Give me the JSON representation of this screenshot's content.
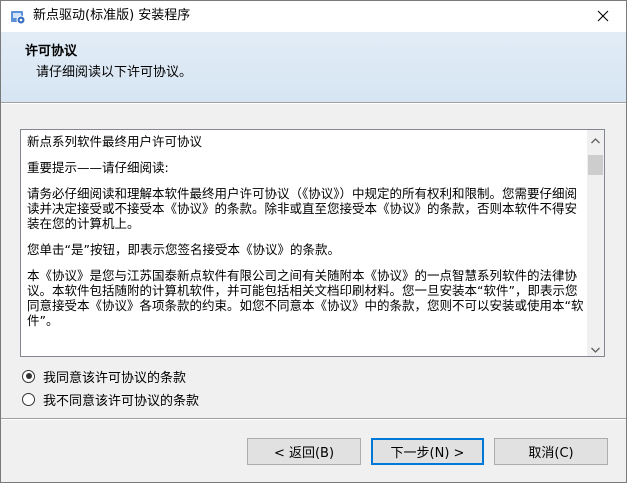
{
  "window": {
    "title": "新点驱动(标准版) 安装程序"
  },
  "header": {
    "title": "许可协议",
    "subtitle": "请仔细阅读以下许可协议。"
  },
  "license": {
    "paragraphs": [
      "新点系列软件最终用户许可协议",
      "重要提示——请仔细阅读:",
      "请务必仔细阅读和理解本软件最终用户许可协议（《协议》）中规定的所有权利和限制。您需要仔细阅读并决定接受或不接受本《协议》的条款。除非或直至您接受本《协议》的条款，否则本软件不得安装在您的计算机上。",
      "您单击“是”按钮，即表示您签名接受本《协议》的条款。",
      "本《协议》是您与江苏国泰新点软件有限公司之间有关随附本《协议》的一点智慧系列软件的法律协议。本软件包括随附的计算机软件，并可能包括相关文档印刷材料。您一旦安装本“软件”，即表示您同意接受本《协议》各项条款的约束。如您不同意本《协议》中的条款，您则不可以安装或使用本“软件”。"
    ]
  },
  "options": {
    "accept_label": "我同意该许可协议的条款",
    "decline_label": "我不同意该许可协议的条款",
    "selected": "accept"
  },
  "buttons": {
    "back_label": "< 返回(B)",
    "next_label": "下一步(N) >",
    "cancel_label": "取消(C)"
  },
  "icons": {
    "app": "installer-app-icon",
    "close": "close-icon",
    "scroll_up": "chevron-up-icon",
    "scroll_down": "chevron-down-icon"
  },
  "colors": {
    "header_bg": "#dbe8f5",
    "default_button_border": "#0078d7",
    "button_bg": "#e1e1e1"
  }
}
